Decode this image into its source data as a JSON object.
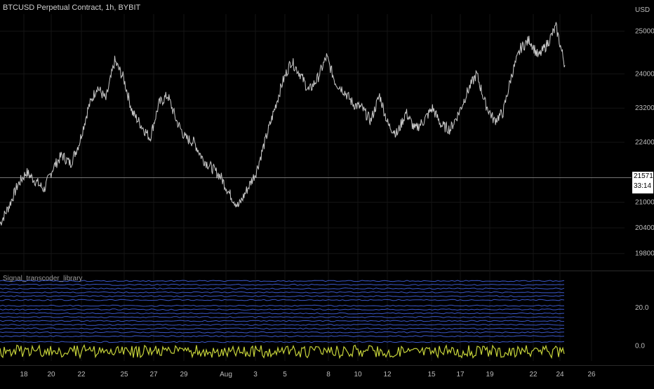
{
  "header": {
    "symbol_title": "BTCUSD Perpetual Contract, 1h, BYBIT"
  },
  "currency": "USD",
  "last_price": {
    "value": "21571.5",
    "countdown": "33:14"
  },
  "indicator": {
    "name": "Signal_transcoder_library"
  },
  "colors": {
    "background": "#000000",
    "price_line": "#c8c8c8",
    "grid": "#141414",
    "indicator_lines": "#3b57c9",
    "oscillator": "#c6d33a"
  },
  "chart_data": [
    {
      "type": "line",
      "title": "BTCUSD Perpetual Contract, 1h, BYBIT",
      "y_unit": "USD",
      "ylim": [
        19500,
        25400
      ],
      "y_ticks": [
        "25000.0",
        "24000.0",
        "23200.0",
        "22400.0",
        "21000.0",
        "20400.0",
        "19800.0"
      ],
      "y_tick_values": [
        25000,
        24000,
        23200,
        22400,
        21000,
        20400,
        19800
      ],
      "x_ticks": [
        "18",
        "20",
        "22",
        "25",
        "27",
        "29",
        "Aug",
        "3",
        "5",
        "8",
        "10",
        "12",
        "15",
        "17",
        "19",
        "22",
        "24",
        "26"
      ],
      "series": [
        {
          "x_day_index": [
            0,
            0.6,
            1.2,
            1.8,
            2.4,
            3.0,
            3.6,
            4.2,
            4.8,
            5.4,
            6.0,
            6.6,
            7.2,
            7.8,
            8.4,
            9.0,
            9.6,
            10.2,
            10.8,
            11.4,
            12.0,
            12.6,
            13.2,
            13.8,
            14.4,
            15.0,
            15.6,
            16.2,
            16.8,
            17.4,
            18.0,
            18.6,
            19.2,
            19.8,
            20.4,
            21.0,
            21.6,
            22.2,
            22.8,
            23.4,
            24.0,
            24.6,
            25.2,
            25.8,
            26.4,
            27.0,
            27.6,
            28.2,
            28.8,
            29.4,
            30.0,
            30.6,
            31.2,
            31.8,
            32.4,
            33.0,
            33.6,
            34.2,
            34.8,
            35.4,
            36.0,
            36.6,
            37.2,
            37.8,
            38.4
          ],
          "values": [
            20500,
            20900,
            21400,
            21700,
            21500,
            21300,
            21800,
            22100,
            21900,
            22400,
            23200,
            23700,
            23400,
            24300,
            23900,
            23100,
            22800,
            22500,
            23300,
            23500,
            22900,
            22500,
            22400,
            22000,
            21800,
            21600,
            21200,
            20900,
            21300,
            21700,
            22400,
            23100,
            23800,
            24300,
            24000,
            23600,
            23900,
            24400,
            23800,
            23600,
            23300,
            23200,
            22900,
            23500,
            22800,
            22600,
            23100,
            22700,
            22900,
            23200,
            22800,
            22700,
            23100,
            23600,
            24000,
            23300,
            22900,
            23100,
            24000,
            24600,
            24800,
            24400,
            24700,
            25100,
            24200
          ]
        }
      ]
    },
    {
      "type": "line",
      "title": "Signal_transcoder_library",
      "y_ticks": [
        "20.0",
        "0.0"
      ],
      "y_tick_values": [
        20,
        0
      ],
      "x_ticks": [
        "18",
        "20",
        "22",
        "25",
        "27",
        "29",
        "Aug",
        "3",
        "5",
        "8",
        "10",
        "12",
        "15",
        "17",
        "19",
        "22",
        "24",
        "26"
      ],
      "series": [
        {
          "name": "",
          "level": 34
        },
        {
          "name": "",
          "level": 32
        },
        {
          "name": "",
          "level": 30
        },
        {
          "name": "",
          "level": 28
        },
        {
          "name": "",
          "level": 26
        },
        {
          "name": "",
          "level": 24
        },
        {
          "name": "",
          "level": 21
        },
        {
          "name": "",
          "level": 19
        },
        {
          "name": "",
          "level": 17
        },
        {
          "name": "",
          "level": 15
        },
        {
          "name": "",
          "level": 13
        },
        {
          "name": "",
          "level": 11
        },
        {
          "name": "",
          "level": 9
        },
        {
          "name": "",
          "level": 7
        },
        {
          "name": "",
          "level": 5
        },
        {
          "name": "",
          "level": 2
        },
        {
          "name": "",
          "level": -3
        }
      ]
    }
  ]
}
